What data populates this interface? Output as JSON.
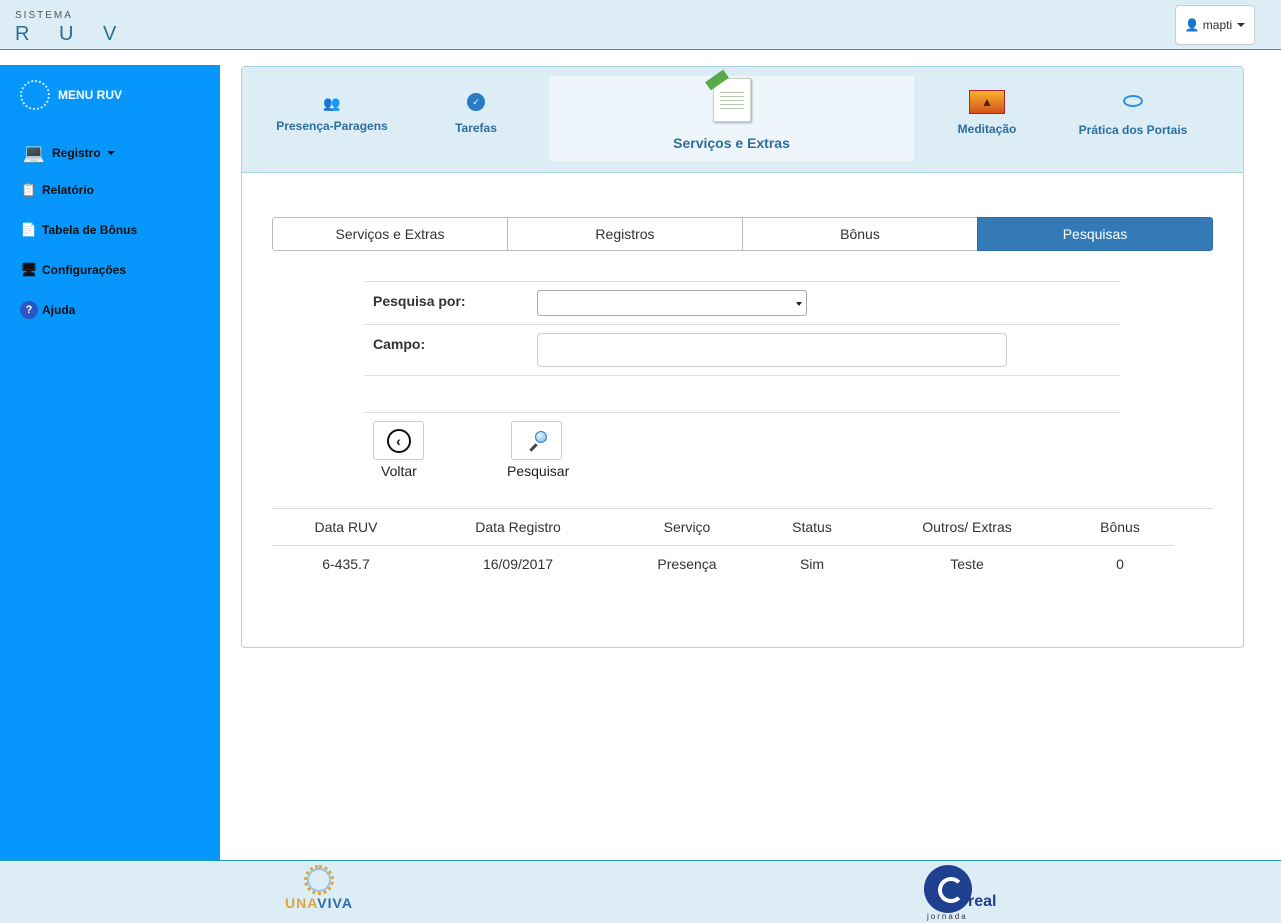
{
  "header": {
    "system_label": "SISTEMA",
    "app_title": "R U V",
    "user_name": "mapti"
  },
  "sidebar": {
    "menu_title": "MENU RUV",
    "items": [
      {
        "label": "Registro",
        "icon": "user-computer-icon",
        "has_dropdown": true
      },
      {
        "label": "Relatório",
        "icon": "report-icon"
      },
      {
        "label": "Tabela de Bônus",
        "icon": "bonus-table-icon"
      },
      {
        "label": "Configurações",
        "icon": "settings-icon"
      },
      {
        "label": "Ajuda",
        "icon": "help-icon"
      }
    ]
  },
  "topnav": {
    "items": [
      {
        "label": "Presença-Paragens",
        "icon": "people-icon"
      },
      {
        "label": "Tarefas",
        "icon": "tasks-icon"
      },
      {
        "label": "Serviços e Extras",
        "icon": "document-icon",
        "active": true
      },
      {
        "label": "Meditação",
        "icon": "meditation-icon"
      },
      {
        "label": "Prática dos Portais",
        "icon": "portal-icon"
      }
    ]
  },
  "tabs": [
    {
      "label": "Serviços e Extras"
    },
    {
      "label": "Registros"
    },
    {
      "label": "Bônus"
    },
    {
      "label": "Pesquisas",
      "active": true
    }
  ],
  "form": {
    "search_by_label": "Pesquisa por:",
    "search_by_value": "",
    "field_label": "Campo:",
    "field_value": ""
  },
  "actions": {
    "back_label": "Voltar",
    "search_label": "Pesquisar"
  },
  "table": {
    "headers": [
      "Data RUV",
      "Data Registro",
      "Serviço",
      "Status",
      "Outros/ Extras",
      "Bônus"
    ],
    "rows": [
      [
        "6-435.7",
        "16/09/2017",
        "Presença",
        "Sim",
        "Teste",
        "0"
      ]
    ]
  },
  "footer": {
    "logo_left_a": "UNA",
    "logo_left_b": "VIVA",
    "logo_right": "real",
    "logo_right_sub": "jornada"
  },
  "colors": {
    "sidebar": "#0796fc",
    "header_bg": "#dcedf5",
    "active_tab": "#337ab7",
    "nav_text": "#2c6e9e"
  }
}
